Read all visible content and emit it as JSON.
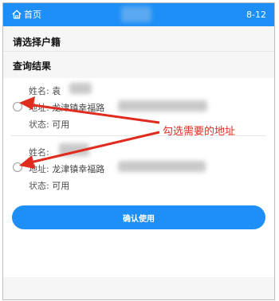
{
  "topbar": {
    "home_label": "首页",
    "right_text": "8-12"
  },
  "sections": {
    "select_title": "请选择户籍",
    "result_title": "查询结果"
  },
  "results": [
    {
      "name_label": "姓名:",
      "name_value": "袁",
      "address_label": "地址:",
      "address_value": "龙津镇幸福路",
      "status_label": "状态:",
      "status_value": "可用"
    },
    {
      "name_label": "姓名:",
      "name_value": "",
      "address_label": "地址:",
      "address_value": "龙津镇幸福路",
      "status_label": "状态:",
      "status_value": "可用"
    }
  ],
  "annotation": {
    "text": "勾选需要的地址",
    "color": "#e02b1f"
  },
  "confirm_button": {
    "label": "确认使用"
  },
  "colors": {
    "accent": "#1e8ff7",
    "page_bg": "#f6f6f6"
  }
}
